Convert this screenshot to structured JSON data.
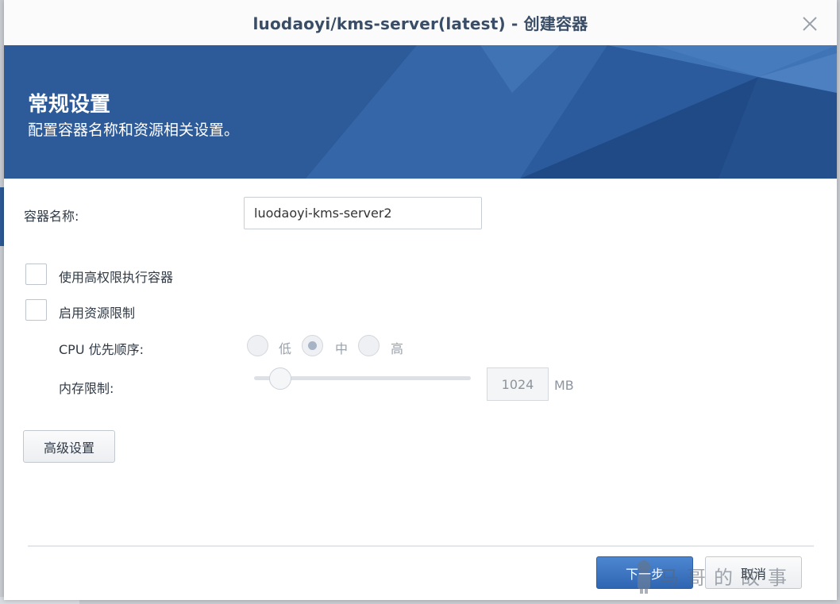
{
  "dialog": {
    "title": "luodaoyi/kms-server(latest) - 创建容器"
  },
  "banner": {
    "title": "常规设置",
    "subtitle": "配置容器名称和资源相关设置。"
  },
  "form": {
    "container_name_label": "容器名称:",
    "container_name_value": "luodaoyi-kms-server2",
    "privileged_label": "使用高权限执行容器",
    "privileged_checked": false,
    "resource_limit_label": "启用资源限制",
    "resource_limit_checked": false,
    "cpu_priority_label": "CPU 优先顺序:",
    "cpu_options": [
      "低",
      "中",
      "高"
    ],
    "cpu_selected": "中",
    "memory_limit_label": "内存限制:",
    "memory_value": "1024",
    "memory_unit": "MB",
    "memory_slider_fraction": 0.12
  },
  "buttons": {
    "advanced": "高级设置",
    "next": "下一步",
    "cancel": "取消"
  },
  "watermark": {
    "text": "马哥的故事"
  },
  "colors": {
    "primary": "#2f66b3",
    "banner": "#2f5e9e",
    "title_text": "#3a4d66"
  }
}
